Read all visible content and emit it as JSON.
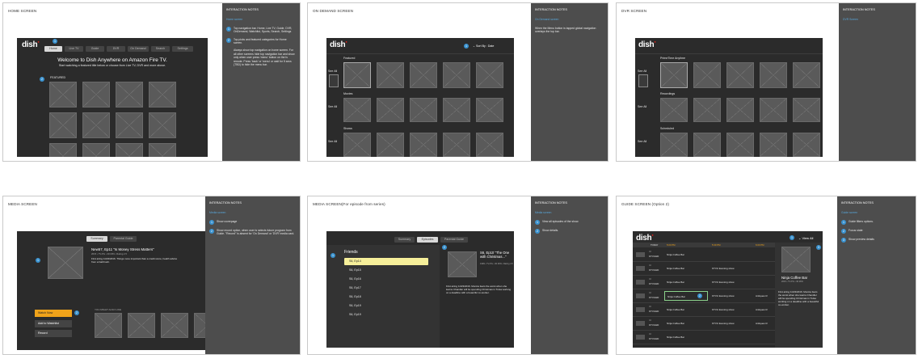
{
  "screens": {
    "home": {
      "title": "HOME SCREEN",
      "logo": "dish",
      "nav": [
        "Home",
        "Live TV",
        "Guide",
        "DVR",
        "On Demand",
        "Search",
        "Settings"
      ],
      "welcome": "Welcome to Dish Anywhere on Amazon Fire TV.",
      "welcome_sub": "Start watching a featured title below or choose from Live TV, DVR and more above.",
      "featured": "FEATURED",
      "badges": [
        "1",
        "2"
      ],
      "notes_head": "INTERACTION NOTES",
      "notes_sub": "Home screen",
      "notes": [
        {
          "n": "1",
          "text": "Top navigation bar. Home, Live TV, Guide, DVR, OnDemand, Watchlist, Sports, Search, Settings"
        },
        {
          "n": "2",
          "text": "Top picks and featured categories for Home screen."
        }
      ],
      "notes_extra": "Always show top navigation on home screen. For all other screens hide top navigation bar and show only when user press 'menu' button on the tv remote. Press 'back' or 'menu' or wait for 5 secs (TBD) to hide the menu bar."
    },
    "ondemand": {
      "title": "ON DEMAND SCREEN",
      "logo": "dish",
      "sort": "Sort By : Date",
      "badge": "1",
      "rows": [
        "Featured",
        "Movies",
        "Shows"
      ],
      "see_all": "See All",
      "notes_head": "INTERACTION NOTES",
      "notes_sub": "On Demand screen",
      "notes_extra": "When the Menu button is tapped global navigation overlays the top bar."
    },
    "dvr": {
      "title": "DVR SCREEN",
      "logo": "dish",
      "rows": [
        "PrimeTime Anytime",
        "Recordings",
        "Scheduled"
      ],
      "see_all": "See All",
      "notes_head": "INTERACTION NOTES",
      "notes_sub": "DVR Screen"
    },
    "media": {
      "title": "MEDIA SCREEN",
      "tabs": [
        "Summary",
        "Parental Guide"
      ],
      "show_title": "New57, Ep11 \"Is Money Stress Matters\"",
      "meta": "2015 • TV-PG • 30 MIN • Rating 2.5",
      "desc": "First airing 11/23/2016. Things more important than a credit score, health advice from a hairbrush.",
      "buttons": [
        "Watch Now",
        "Add to Watchlist",
        "Record"
      ],
      "may_like": "YOU MIGHT ALSO LIKE",
      "badges": [
        "1",
        "2"
      ],
      "notes_head": "INTERACTION NOTES",
      "notes_sub": "Media screen",
      "notes": [
        {
          "n": "1",
          "text": "Show coverpage"
        },
        {
          "n": "2",
          "text": "Show record option, when user is selects future program from Guide. \"Record\" is absent for 'On Demand' or 'DVR' media card."
        }
      ]
    },
    "media_episode": {
      "title": "MEDIA SCREEN(For episode from series)",
      "tabs": [
        "Summary",
        "Episodes",
        "Parental Guide"
      ],
      "series": "Friends",
      "episodes": [
        "S6, Ep14",
        "S6, Ep15",
        "S6, Ep16",
        "S6, Ep17",
        "S6, Ep18",
        "S6, Ep19",
        "S6, Ep19"
      ],
      "ep_title": "S6, Ep10 \"The One with Christmas...\"",
      "ep_meta": "1999 • TV-PG • 30 MIN • Rating 4.5",
      "ep_desc": "First airing 11/23/2016. Monica fears the worst when she learns Chandler will be spending Christmas in Tulsa working on a deadline with a beautiful co-worker.",
      "badges": [
        "1",
        "2"
      ],
      "notes_head": "INTERACTION NOTES",
      "notes_sub": "Media screen",
      "notes": [
        {
          "n": "1",
          "text": "View all episodes of the show."
        },
        {
          "n": "2",
          "text": "Show details."
        }
      ]
    },
    "guide": {
      "title": "GUIDE SCREEN (Option 2)",
      "logo": "dish",
      "view_all": "View All",
      "times": [
        "TODAY",
        "5:00 PM",
        "5:30 PM",
        "6:00 PM"
      ],
      "channel": "KTVUHD",
      "channel_num": "02",
      "programs": [
        [
          "Ninja Coffee Bar",
          "",
          ""
        ],
        [
          "Ninja Coffee Bar",
          "KTVU Evening show",
          ""
        ],
        [
          "Ninja Coffee Bar",
          "KTVU Evening show",
          ""
        ],
        [
          "Ninja Coffee Bar",
          "KTVU Evening show",
          "Antiques R"
        ],
        [
          "Ninja Coffee Bar",
          "KTVU Evening show",
          "Antiques R"
        ],
        [
          "Ninja Coffee Bar",
          "KTVU Evening show",
          "Antiques R"
        ],
        [
          "Ninja Coffee Bar",
          "",
          ""
        ]
      ],
      "detail_title": "Ninja Coffee Bar",
      "detail_meta": "2015 • TV-PG • 30 MIN",
      "detail_desc": "First airing 11/23/2016. Monica fears the worst when she learns Chandler will be spending Christmas in Tulsa working on a deadline with a beautiful co-worker.",
      "badges": [
        "1",
        "2",
        "3"
      ],
      "notes_head": "INTERACTION NOTES",
      "notes_sub": "Guide screen",
      "notes": [
        {
          "n": "1",
          "text": "Guide filters options."
        },
        {
          "n": "2",
          "text": "Focus state"
        },
        {
          "n": "3",
          "text": "Show preview details"
        }
      ]
    }
  },
  "colors": {
    "accent": "#3a92cf",
    "primary_button": "#f0a31a",
    "selected_episode": "#f6ef9a",
    "brand_red": "#e2231a"
  }
}
